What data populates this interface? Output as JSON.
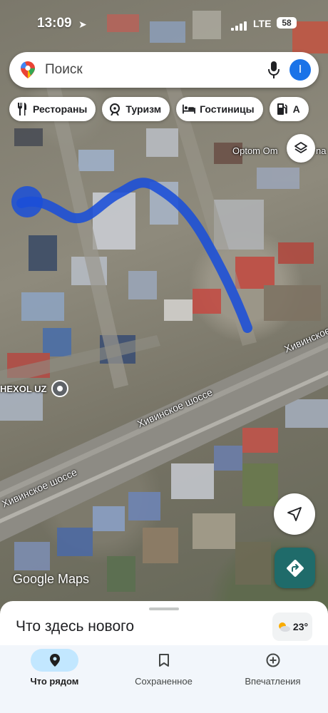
{
  "status_bar": {
    "time": "13:09",
    "network": "LTE",
    "battery": "58"
  },
  "search": {
    "placeholder": "Поиск",
    "avatar_letter": "I"
  },
  "chips": [
    {
      "label": "Рестораны",
      "icon": "restaurant-icon"
    },
    {
      "label": "Туризм",
      "icon": "attractions-icon"
    },
    {
      "label": "Гостиницы",
      "icon": "hotel-icon"
    },
    {
      "label": "А",
      "icon": "gas-station-icon"
    }
  ],
  "map": {
    "labels": {
      "optom": "Optom Om",
      "optom_tail": "na",
      "place": "HEXOL UZ",
      "road_1": "Хивинское шоссе",
      "road_2": "Хивинское шоссе",
      "road_3": "Хивинское шоссе",
      "attribution": "Google Maps"
    },
    "route_color": "#1a4fd8"
  },
  "sheet": {
    "title": "Что здесь нового",
    "temperature": "23°"
  },
  "bottom_nav": [
    {
      "label": "Что рядом",
      "icon": "explore-pin-icon",
      "active": true
    },
    {
      "label": "Сохраненное",
      "icon": "bookmark-icon",
      "active": false
    },
    {
      "label": "Впечатления",
      "icon": "add-contribute-icon",
      "active": false
    }
  ]
}
